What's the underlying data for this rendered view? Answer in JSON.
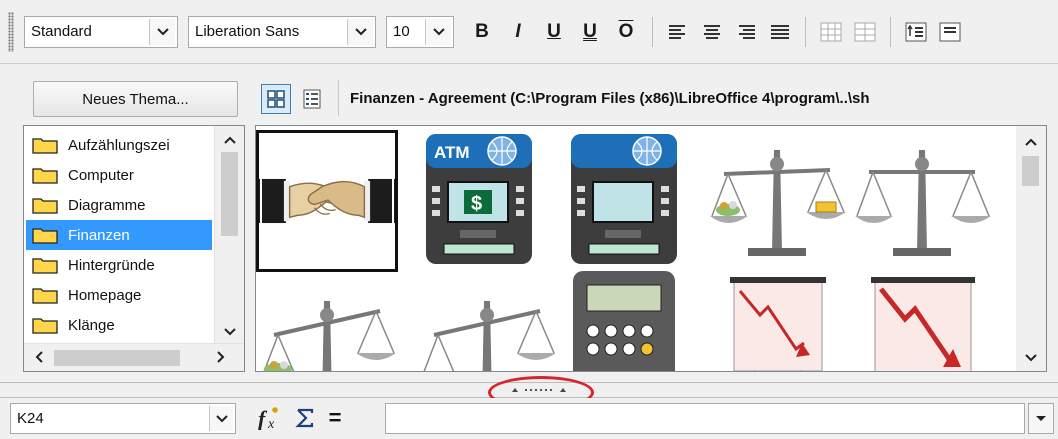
{
  "toolbar": {
    "paragraph_style": "Standard",
    "font_name": "Liberation Sans",
    "font_size": "10",
    "bold_glyph": "B",
    "italic_glyph": "I",
    "underline_glyph": "U",
    "double_underline_glyph": "U",
    "overline_glyph": "O",
    "buttons": [
      "bold-icon",
      "italic-icon",
      "underline-icon",
      "double-underline-icon",
      "overline-icon",
      "align-left-icon",
      "align-center-icon",
      "align-right-icon",
      "justify-icon",
      "merge-cells-icon",
      "unmerge-cells-icon",
      "wrap-text-icon"
    ]
  },
  "gallery": {
    "new_theme_label": "Neues Thema...",
    "path_title": "Finanzen - Agreement (C:\\Program Files (x86)\\LibreOffice 4\\program\\..\\sh",
    "themes": [
      {
        "label": "Aufzählungszei",
        "selected": false
      },
      {
        "label": "Computer",
        "selected": false
      },
      {
        "label": "Diagramme",
        "selected": false
      },
      {
        "label": "Finanzen",
        "selected": true
      },
      {
        "label": "Hintergründe",
        "selected": false
      },
      {
        "label": "Homepage",
        "selected": false
      },
      {
        "label": "Klänge",
        "selected": false
      }
    ],
    "tiles": [
      {
        "icon": "handshake-icon",
        "selected": true
      },
      {
        "icon": "atm-machine-icon",
        "caption": "ATM",
        "symbol": "$"
      },
      {
        "icon": "atm-machine-blank-icon"
      },
      {
        "icon": "scale-with-money-icon"
      },
      {
        "icon": "scale-icon"
      },
      {
        "icon": "scale-with-money-tilted-icon"
      },
      {
        "icon": "scale-tilted-icon"
      },
      {
        "icon": "calculator-icon"
      },
      {
        "icon": "falling-chart-icon"
      },
      {
        "icon": "falling-chart-arrow-icon"
      }
    ]
  },
  "formula_bar": {
    "name_box": "K24",
    "function_wizard_icon": "function-wizard-icon",
    "sum_icon": "sum-icon",
    "equals_glyph": "="
  },
  "colors": {
    "selection": "#3399ff",
    "highlight_circle": "#d9232a",
    "folder_fill": "#ffd54a"
  }
}
